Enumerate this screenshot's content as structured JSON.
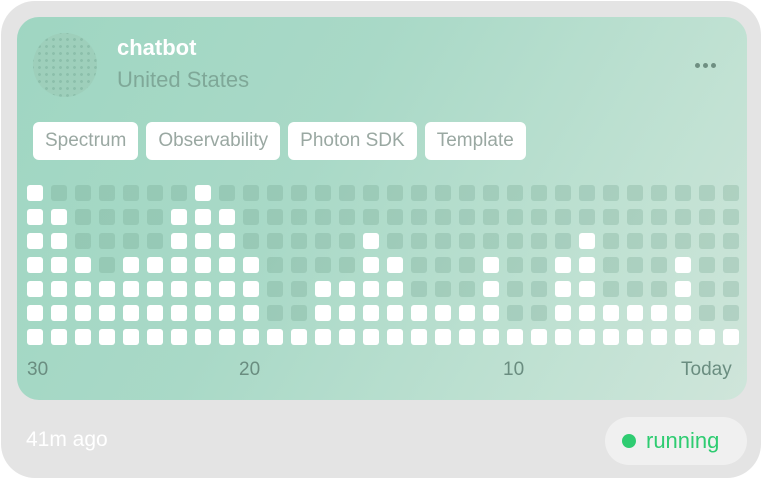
{
  "card": {
    "name": "chatbot",
    "location": "United States",
    "tags": [
      "Spectrum",
      "Observability",
      "Photon SDK",
      "Template"
    ],
    "time_ago": "41m ago",
    "status": "running",
    "status_color": "#2ecc71",
    "menu_icon": "more-horizontal-icon"
  },
  "activity": {
    "x_labels": [
      "30",
      "20",
      "10",
      "Today"
    ],
    "days_ago": [
      30,
      29,
      28,
      27,
      26,
      25,
      24,
      23,
      22,
      21,
      20,
      19,
      18,
      17,
      16,
      15,
      14,
      13,
      12,
      11,
      10,
      9,
      8,
      7,
      6,
      5,
      4,
      3,
      2,
      1
    ],
    "levels": [
      7,
      6,
      4,
      3,
      4,
      4,
      6,
      7,
      6,
      4,
      1,
      1,
      3,
      3,
      5,
      4,
      2,
      2,
      2,
      4,
      1,
      1,
      4,
      5,
      2,
      2,
      2,
      4,
      1,
      1
    ],
    "max_level": 7
  }
}
